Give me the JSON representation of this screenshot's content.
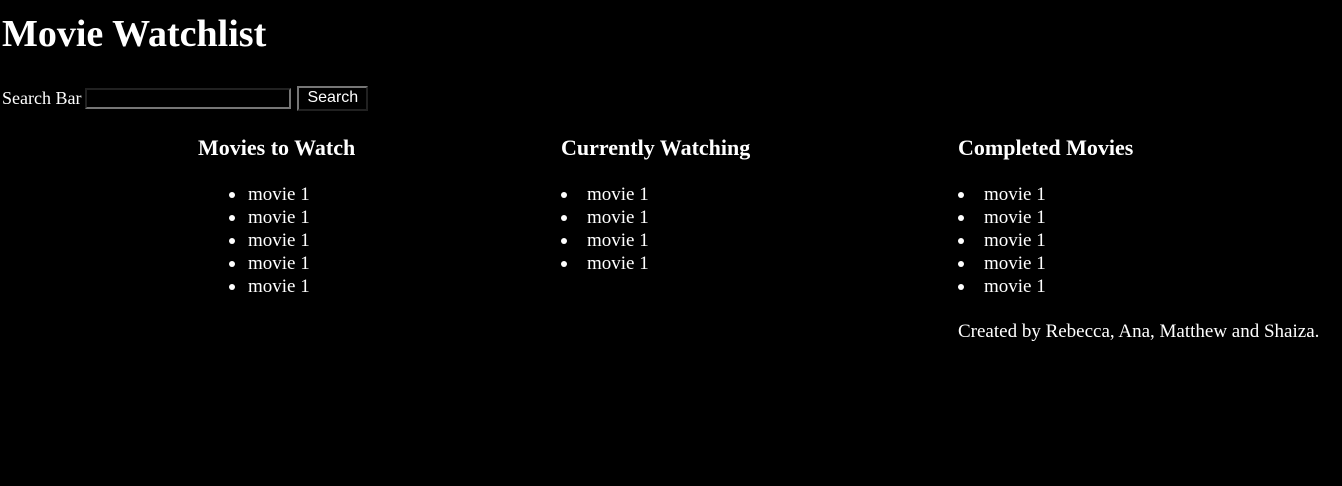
{
  "page": {
    "title": "Movie Watchlist"
  },
  "search": {
    "label": "Search Bar",
    "value": "",
    "placeholder": "",
    "button_label": "Search"
  },
  "columns": [
    {
      "heading": "Movies to Watch",
      "items": [
        "movie 1",
        "movie 1",
        "movie 1",
        "movie 1",
        "movie 1"
      ]
    },
    {
      "heading": "Currently Watching",
      "items": [
        "movie 1",
        "movie 1",
        "movie 1",
        "movie 1"
      ]
    },
    {
      "heading": "Completed Movies",
      "items": [
        "movie 1",
        "movie 1",
        "movie 1",
        "movie 1",
        "movie 1"
      ]
    }
  ],
  "footer": {
    "credits": "Created by Rebecca, Ana, Matthew and Shaiza."
  },
  "colors": {
    "background": "#000000",
    "text": "#ffffff",
    "control_border": "#767676"
  }
}
